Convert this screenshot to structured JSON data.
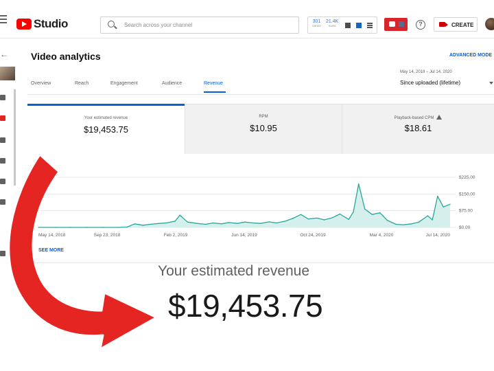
{
  "topbar": {
    "logo_text": "Studio",
    "search_placeholder": "Search across your channel",
    "stat_a_value": "301",
    "stat_a_label": "VIEWS",
    "stat_b_value": "21.4K",
    "stat_b_label": "SUBS",
    "create_label": "CREATE",
    "help_glyph": "?"
  },
  "page": {
    "title": "Video analytics",
    "advanced_mode": "ADVANCED MODE",
    "date_range": "May 14, 2018 – Jul 14, 2020",
    "period": "Since uploaded (lifetime)",
    "tabs": [
      "Overview",
      "Reach",
      "Engagement",
      "Audience",
      "Revenue"
    ],
    "active_tab": "Revenue",
    "see_more": "SEE MORE"
  },
  "cards": [
    {
      "label": "Your estimated revenue",
      "value": "$19,453.75"
    },
    {
      "label": "RPM",
      "value": "$10.95"
    },
    {
      "label": "Playback-based CPM",
      "value": "$18.61"
    }
  ],
  "callout": {
    "label": "Your estimated revenue",
    "value": "$19,453.75"
  },
  "colors": {
    "accent": "#065fd4",
    "chart_line": "#26a69a",
    "chart_fill": "#d5efec",
    "arrow": "#e52521"
  },
  "chart_data": {
    "type": "area",
    "x_tick_labels": [
      "May 14, 2018",
      "Sep 23, 2018",
      "Feb 2, 2019",
      "Jun 14, 2019",
      "Oct 24, 2019",
      "Mar 4, 2020",
      "Jul 14, 2020"
    ],
    "y_tick_labels": [
      "$225.00",
      "$150.00",
      "$75.00",
      "$0.00"
    ],
    "ylim": [
      0,
      225
    ],
    "y_axis_position": "right",
    "grid": true,
    "x": [
      "2018-05-14",
      "2018-06-15",
      "2018-07-15",
      "2018-08-15",
      "2018-09-15",
      "2018-10-15",
      "2018-11-01",
      "2018-11-15",
      "2018-12-01",
      "2018-12-15",
      "2019-01-01",
      "2019-01-15",
      "2019-02-01",
      "2019-02-10",
      "2019-02-25",
      "2019-03-15",
      "2019-04-01",
      "2019-04-15",
      "2019-05-01",
      "2019-05-15",
      "2019-06-01",
      "2019-06-15",
      "2019-07-01",
      "2019-07-15",
      "2019-08-01",
      "2019-08-15",
      "2019-09-01",
      "2019-09-15",
      "2019-10-01",
      "2019-10-15",
      "2019-11-01",
      "2019-11-15",
      "2019-12-01",
      "2019-12-15",
      "2020-01-01",
      "2020-01-10",
      "2020-01-20",
      "2020-02-01",
      "2020-02-15",
      "2020-03-01",
      "2020-03-15",
      "2020-04-01",
      "2020-04-15",
      "2020-05-01",
      "2020-05-15",
      "2020-06-01",
      "2020-06-10",
      "2020-06-20",
      "2020-07-01",
      "2020-07-14"
    ],
    "values": [
      0,
      0,
      0,
      0,
      0,
      0,
      2,
      16,
      10,
      14,
      18,
      20,
      28,
      55,
      24,
      18,
      14,
      20,
      16,
      22,
      18,
      24,
      20,
      18,
      25,
      20,
      28,
      40,
      58,
      38,
      42,
      34,
      44,
      60,
      36,
      70,
      195,
      82,
      58,
      66,
      32,
      14,
      12,
      16,
      24,
      52,
      34,
      140,
      92,
      104
    ]
  }
}
